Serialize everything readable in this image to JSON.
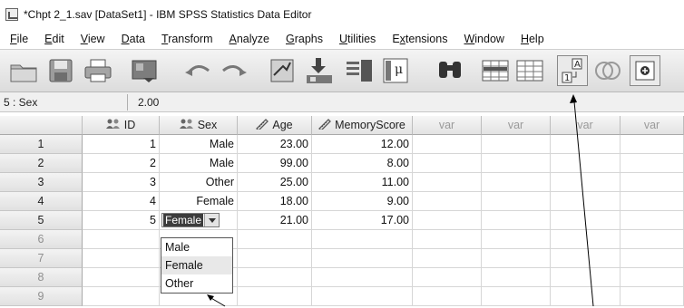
{
  "window": {
    "title": "*Chpt 2_1.sav [DataSet1] - IBM SPSS Statistics Data Editor"
  },
  "menu": [
    {
      "label": "File",
      "mnemonic_index": 0
    },
    {
      "label": "Edit",
      "mnemonic_index": 0
    },
    {
      "label": "View",
      "mnemonic_index": 0
    },
    {
      "label": "Data",
      "mnemonic_index": 0
    },
    {
      "label": "Transform",
      "mnemonic_index": 0
    },
    {
      "label": "Analyze",
      "mnemonic_index": 0
    },
    {
      "label": "Graphs",
      "mnemonic_index": 0
    },
    {
      "label": "Utilities",
      "mnemonic_index": 0
    },
    {
      "label": "Extensions",
      "mnemonic_index": 1
    },
    {
      "label": "Window",
      "mnemonic_index": 0
    },
    {
      "label": "Help",
      "mnemonic_index": 0
    }
  ],
  "toolbar": {
    "icons": [
      "open-folder-icon",
      "save-icon",
      "print-icon",
      "dialog-recall-icon",
      "undo-icon",
      "redo-icon",
      "go-to-case-icon",
      "go-to-variable-icon",
      "variables-icon",
      "run-descriptives-icon",
      "find-icon",
      "insert-cases-icon",
      "insert-variable-icon",
      "value-labels-icon",
      "use-variable-sets-icon",
      "show-all-variables-icon"
    ],
    "value_labels_glyph_top": "A",
    "value_labels_glyph_bottom": "1"
  },
  "cell_editor": {
    "reference": "5 : Sex",
    "value": "2.00"
  },
  "grid": {
    "columns": [
      {
        "name": "ID",
        "icon": "nominal-measure-icon"
      },
      {
        "name": "Sex",
        "icon": "nominal-measure-icon"
      },
      {
        "name": "Age",
        "icon": "scale-measure-icon"
      },
      {
        "name": "MemoryScore",
        "icon": "scale-measure-icon"
      },
      {
        "name": "var",
        "icon": ""
      },
      {
        "name": "var",
        "icon": ""
      },
      {
        "name": "var",
        "icon": ""
      },
      {
        "name": "var",
        "icon": ""
      }
    ],
    "rows": [
      {
        "num": "1",
        "cells": [
          "1",
          "Male",
          "23.00",
          "12.00"
        ]
      },
      {
        "num": "2",
        "cells": [
          "2",
          "Male",
          "99.00",
          "8.00"
        ]
      },
      {
        "num": "3",
        "cells": [
          "3",
          "Other",
          "25.00",
          "11.00"
        ]
      },
      {
        "num": "4",
        "cells": [
          "4",
          "Female",
          "18.00",
          "9.00"
        ]
      },
      {
        "num": "5",
        "cells": [
          "5",
          "Female",
          "21.00",
          "17.00"
        ]
      },
      {
        "num": "6",
        "cells": [
          "",
          "",
          "",
          ""
        ]
      },
      {
        "num": "7",
        "cells": [
          "",
          "",
          "",
          ""
        ]
      },
      {
        "num": "8",
        "cells": [
          "",
          "",
          "",
          ""
        ]
      },
      {
        "num": "9",
        "cells": [
          "",
          "",
          "",
          ""
        ]
      }
    ],
    "active_row_index": 4
  },
  "sex_dropdown": {
    "selected": "Female",
    "options": [
      "Male",
      "Female",
      "Other"
    ],
    "highlighted_option": "Female"
  },
  "colors": {
    "selection": "#3c3c3c",
    "header_top": "#f7f7f7",
    "header_bottom": "#e3e3e3"
  }
}
